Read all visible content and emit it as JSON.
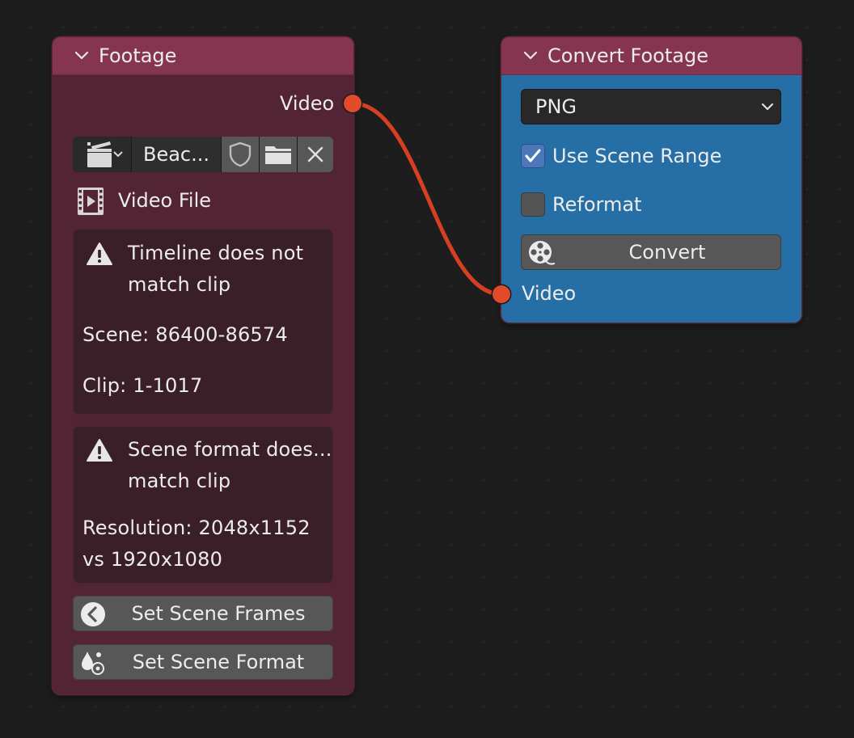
{
  "colors": {
    "canvas_background": "#1d1d1d",
    "node_header": "#863550",
    "footage_body": "#522434",
    "convert_body": "#266fa6",
    "socket": "#e24a2c",
    "wire": "#d63f22"
  },
  "footage_node": {
    "title": "Footage",
    "output_socket_label": "Video",
    "clip_selector": {
      "type_icon": "clapperboard-icon",
      "clip_name": "Beac...",
      "fake_user_icon": "shield-icon",
      "browse_icon": "folder-icon",
      "unlink_icon": "close-icon"
    },
    "source_type_label": "Video File",
    "warnings": [
      {
        "icon": "warning-icon",
        "title_line1": "Timeline does not",
        "title_line2": "match clip",
        "detail1": "Scene: 86400-86574",
        "detail2": "Clip: 1-1017"
      },
      {
        "icon": "warning-icon",
        "title_line1": "Scene format does...",
        "title_line2": "match clip",
        "detail1": "Resolution: 2048x1152",
        "detail2": "vs 1920x1080"
      }
    ],
    "buttons": {
      "set_frames": "Set Scene Frames",
      "set_format": "Set Scene Format"
    }
  },
  "convert_node": {
    "title": "Convert Footage",
    "format_selected": "PNG",
    "use_scene_range_label": "Use Scene Range",
    "use_scene_range_checked": true,
    "reformat_label": "Reformat",
    "reformat_checked": false,
    "convert_button": "Convert",
    "input_socket_label": "Video"
  }
}
